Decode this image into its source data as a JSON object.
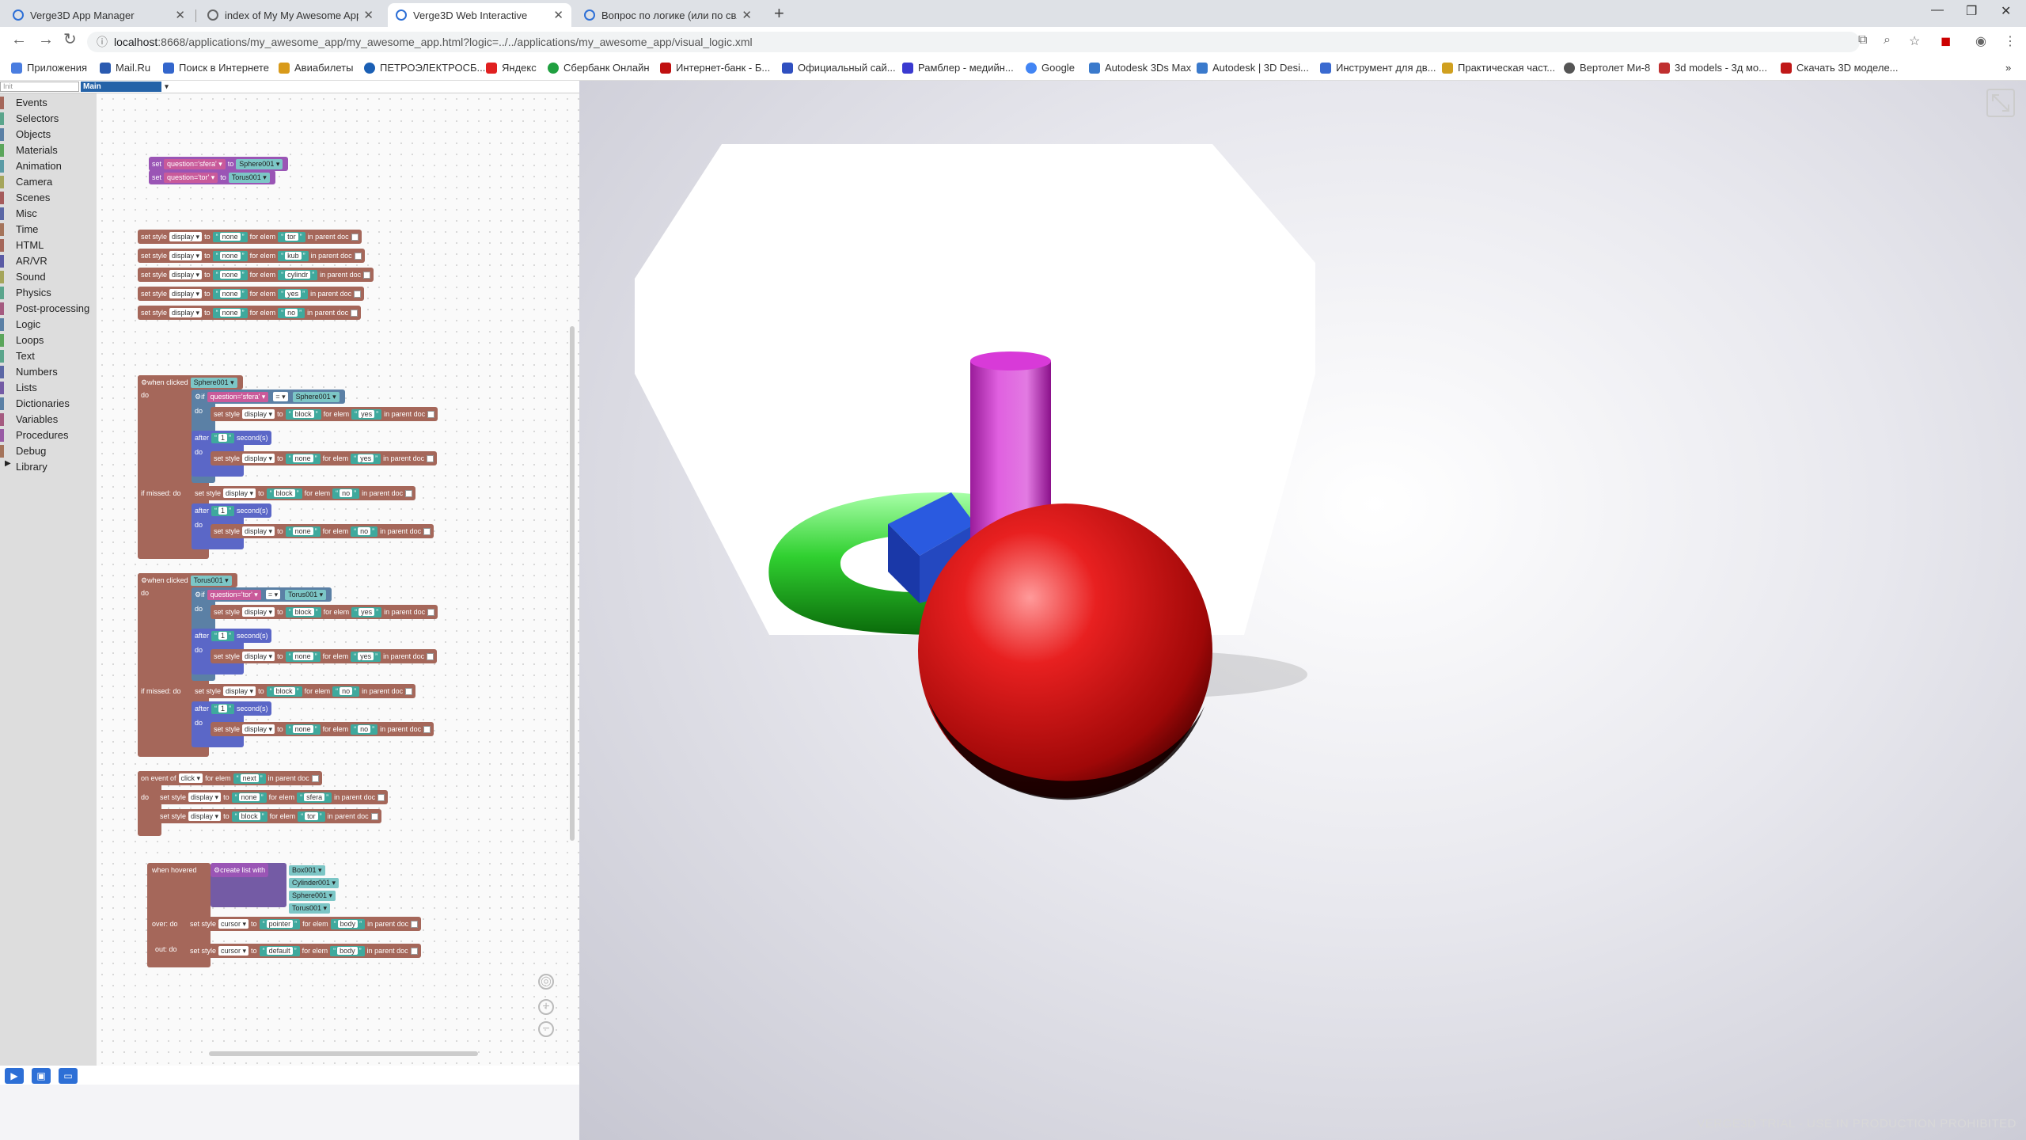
{
  "tabs": [
    {
      "label": "Verge3D App Manager",
      "active": false
    },
    {
      "label": "index of My My Awesome App",
      "active": false
    },
    {
      "label": "Verge3D Web Interactive",
      "active": true
    },
    {
      "label": "Вопрос по логике (или по связ",
      "active": false
    }
  ],
  "url": {
    "host": "localhost",
    "rest": ":8668/applications/my_awesome_app/my_awesome_app.html?logic=../../applications/my_awesome_app/visual_logic.xml"
  },
  "bookmarks": [
    "Приложения",
    "Mail.Ru",
    "Поиск в Интернете",
    "Авиабилеты",
    "ПЕТРОЭЛЕКТРОСБ...",
    "Яндекс",
    "Сбербанк Онлайн",
    "Интернет-банк - Б...",
    "Официальный сай...",
    "Рамблер - медийн...",
    "Google",
    "Autodesk 3Ds Max",
    "Autodesk | 3D Desi...",
    "Инструмент для дв...",
    "Практическая част...",
    "Вертолет Ми-8",
    "3d models - 3д мо...",
    "Скачать 3D моделе..."
  ],
  "editor": {
    "init_placeholder": "Init",
    "main_tab": "Main",
    "categories": [
      {
        "label": "Events",
        "color": "#a5675a"
      },
      {
        "label": "Selectors",
        "color": "#5ba58c"
      },
      {
        "label": "Objects",
        "color": "#5b80a5"
      },
      {
        "label": "Materials",
        "color": "#5ba55b"
      },
      {
        "label": "Animation",
        "color": "#5b9ba5"
      },
      {
        "label": "Camera",
        "color": "#a5a55b"
      },
      {
        "label": "Scenes",
        "color": "#a55b5b"
      },
      {
        "label": "Misc",
        "color": "#5b67a5"
      },
      {
        "label": "Time",
        "color": "#a5745b"
      },
      {
        "label": "HTML",
        "color": "#a5675a"
      },
      {
        "label": "AR/VR",
        "color": "#5b5ba5"
      },
      {
        "label": "Sound",
        "color": "#a5a55b"
      },
      {
        "label": "Physics",
        "color": "#5ba58c"
      },
      {
        "label": "Post-processing",
        "color": "#a55b80"
      },
      {
        "label": "Logic",
        "color": "#5b80a5"
      },
      {
        "label": "Loops",
        "color": "#5ba55b"
      },
      {
        "label": "Text",
        "color": "#5ba58c"
      },
      {
        "label": "Numbers",
        "color": "#5b67a5"
      },
      {
        "label": "Lists",
        "color": "#745ba5"
      },
      {
        "label": "Dictionaries",
        "color": "#5b80a5"
      },
      {
        "label": "Variables",
        "color": "#a55b80"
      },
      {
        "label": "Procedures",
        "color": "#995ba5"
      },
      {
        "label": "Debug",
        "color": "#a5745b"
      },
      {
        "label": "Library",
        "color": "#ffffff",
        "arrow": "▶"
      }
    ]
  },
  "blocks": {
    "set": "set",
    "to": "to",
    "set_style": "set style",
    "for_elem": "for elem",
    "in_parent_doc": "in parent doc",
    "when_clicked": "when clicked",
    "do": "do",
    "if": "if",
    "after": "after",
    "seconds": "second(s)",
    "if_missed_do": "if missed: do",
    "on_event_of": "on event of",
    "click": "click",
    "when_hovered": "when hovered",
    "over_do": "over: do",
    "out_do": "out: do",
    "create_list_with": "create list with",
    "eq": "=",
    "vars": [
      "question='sfera'",
      "question='tor'"
    ],
    "objs": [
      "Sphere001",
      "Torus001",
      "Box001",
      "Cylinder001"
    ],
    "display": "display",
    "cursor": "cursor",
    "none": "none",
    "block": "block",
    "pointer": "pointer",
    "default": "default",
    "body": "body",
    "elems": [
      "tor",
      "kub",
      "cylindr",
      "yes",
      "no",
      "sfera",
      "next"
    ],
    "one": "1"
  },
  "viewer": {
    "trial_text": "VERGE3D TRIAL - USE IN PRODUCTION PROHIBITED"
  },
  "colors": {
    "sphere": "#d01010",
    "torus": "#22cc22",
    "cylinder": "#d64cd6",
    "cube": "#2048c8"
  }
}
